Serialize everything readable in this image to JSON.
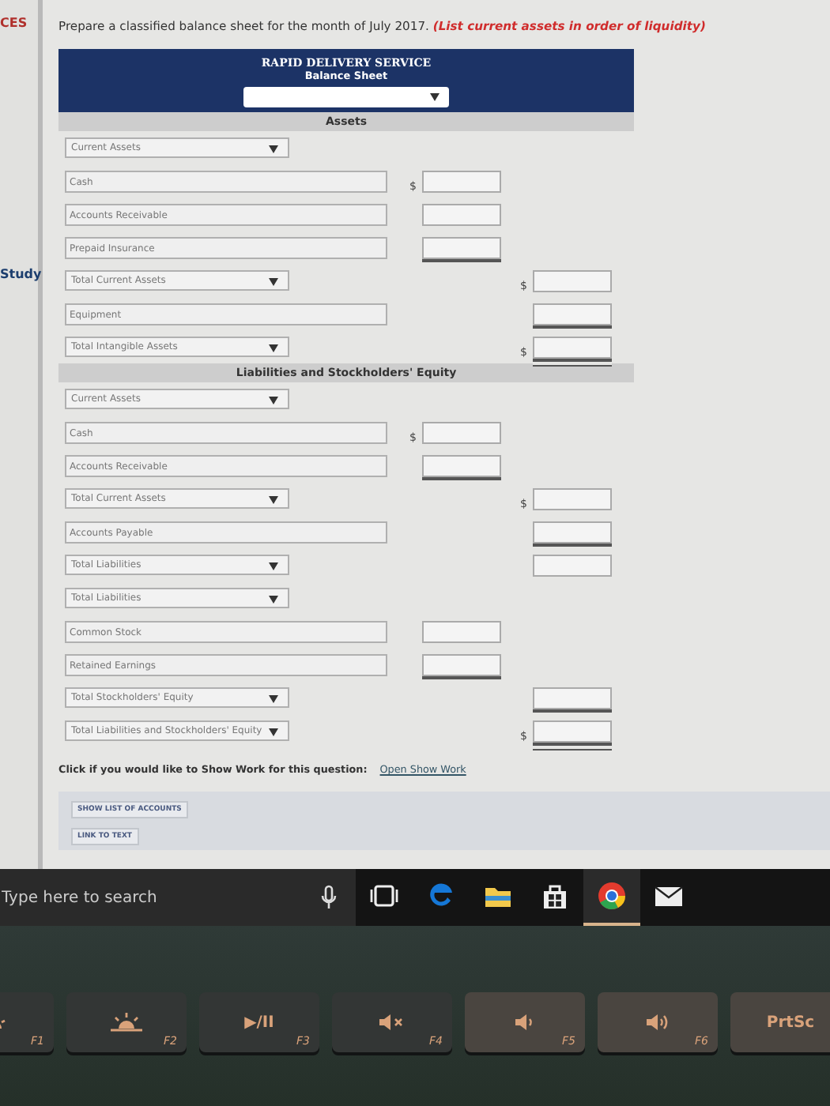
{
  "sidebar": {
    "items": [
      {
        "label": "CES",
        "kind": "alert"
      },
      {
        "label": "Study",
        "kind": "link"
      }
    ]
  },
  "prompt": {
    "text": "Prepare a classified balance sheet for the month of July 2017. ",
    "note": "(List current assets in order of liquidity)"
  },
  "sheet": {
    "company": "RAPID DELIVERY SERVICE",
    "title": "Balance Sheet",
    "sections": [
      {
        "heading": "Assets",
        "rows": [
          {
            "kind": "dropdown",
            "label": "Current Assets"
          },
          {
            "kind": "field",
            "label": "Cash",
            "amount": {
              "kind": "inner",
              "prefix": "$"
            }
          },
          {
            "kind": "field",
            "label": "Accounts Receivable",
            "amount": {
              "kind": "inner"
            }
          },
          {
            "kind": "field",
            "label": "Prepaid Insurance",
            "amount": {
              "kind": "inner-underlined"
            }
          },
          {
            "kind": "dropdown",
            "label": "Total Current Assets",
            "amount": {
              "kind": "outer",
              "prefix": "$"
            }
          },
          {
            "kind": "field",
            "label": "Equipment",
            "amount": {
              "kind": "outer-underlined"
            }
          },
          {
            "kind": "dropdown",
            "label": "Total Intangible Assets",
            "amount": {
              "kind": "outer-double",
              "prefix": "$"
            }
          }
        ]
      },
      {
        "heading": "Liabilities and Stockholders' Equity",
        "rows": [
          {
            "kind": "dropdown",
            "label": "Current Assets"
          },
          {
            "kind": "field",
            "label": "Cash",
            "amount": {
              "kind": "inner",
              "prefix": "$"
            }
          },
          {
            "kind": "field",
            "label": "Accounts Receivable",
            "amount": {
              "kind": "inner-underlined"
            }
          },
          {
            "kind": "dropdown",
            "label": "Total Current Assets",
            "amount": {
              "kind": "outer",
              "prefix": "$"
            }
          },
          {
            "kind": "field",
            "label": "Accounts Payable",
            "amount": {
              "kind": "outer-underlined"
            }
          },
          {
            "kind": "dropdown",
            "label": "Total Liabilities",
            "amount": {
              "kind": "outer"
            }
          },
          {
            "kind": "dropdown",
            "label": "Total Liabilities"
          },
          {
            "kind": "field",
            "label": "Common Stock",
            "amount": {
              "kind": "inner"
            }
          },
          {
            "kind": "field",
            "label": "Retained Earnings",
            "amount": {
              "kind": "inner-underlined"
            }
          },
          {
            "kind": "dropdown",
            "label": "Total Stockholders' Equity",
            "amount": {
              "kind": "outer-underlined"
            }
          },
          {
            "kind": "dropdown",
            "label": "Total Liabilities and Stockholders' Equity",
            "amount": {
              "kind": "outer-double",
              "prefix": "$"
            }
          }
        ]
      }
    ]
  },
  "show_work": {
    "text": "Click if you would like to Show Work for this question:",
    "link": "Open Show Work"
  },
  "buttons": [
    "SHOW LIST OF ACCOUNTS",
    "LINK TO TEXT"
  ],
  "taskbar": {
    "search": {
      "placeholder": "Type here to search"
    },
    "apps": [
      {
        "kind": "taskview",
        "selected": false
      },
      {
        "kind": "browser",
        "selected": false
      },
      {
        "kind": "folder",
        "selected": false
      },
      {
        "kind": "store",
        "selected": false
      },
      {
        "kind": "round",
        "selected": true
      },
      {
        "kind": "mail",
        "selected": false
      }
    ]
  },
  "keyboard": {
    "keys": [
      {
        "kind": "sun-small",
        "fn": "F1"
      },
      {
        "kind": "sun",
        "fn": "F2"
      },
      {
        "kind": "text",
        "symbol": "▶/II",
        "fn": "F3"
      },
      {
        "kind": "mute",
        "fn": "F4"
      },
      {
        "kind": "vol-low",
        "fn": "F5"
      },
      {
        "kind": "vol-high",
        "fn": "F6"
      },
      {
        "kind": "text",
        "symbol": "PrtSc"
      }
    ]
  }
}
